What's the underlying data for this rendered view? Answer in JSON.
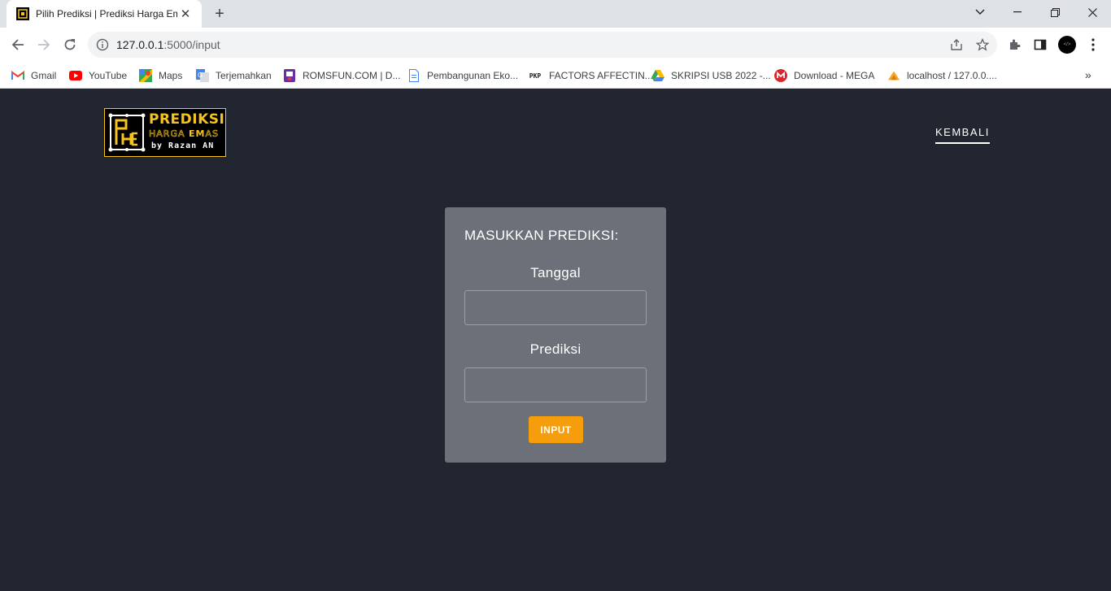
{
  "browser": {
    "tab_title": "Pilih Prediksi | Prediksi Harga Emas",
    "url_host": "127.0.0.1",
    "url_path": ":5000/input",
    "profile_text": "</>",
    "bookmarks": [
      {
        "label": "Gmail",
        "icon": "gmail-icon"
      },
      {
        "label": "YouTube",
        "icon": "youtube-icon"
      },
      {
        "label": "Maps",
        "icon": "maps-icon"
      },
      {
        "label": "Terjemahkan",
        "icon": "translate-icon"
      },
      {
        "label": "ROMSFUN.COM | D...",
        "icon": "romsfun-icon"
      },
      {
        "label": "Pembangunan Eko...",
        "icon": "document-icon"
      },
      {
        "label": "FACTORS AFFECTIN...",
        "icon": "pkp-icon"
      },
      {
        "label": "SKRIPSI USB 2022 -...",
        "icon": "drive-icon"
      },
      {
        "label": "Download - MEGA",
        "icon": "mega-icon"
      },
      {
        "label": "localhost / 127.0.0....",
        "icon": "phpmyadmin-icon"
      }
    ],
    "bookmark_pkp_text": "PKP"
  },
  "logo": {
    "line1": "PREDIKSI",
    "line2a": "HARGA ",
    "line2b": "EM",
    "line2c": "AS",
    "line3": "by Razan AN"
  },
  "nav": {
    "back_label": "KEMBALI"
  },
  "form": {
    "title": "MASUKKAN PREDIKSI:",
    "date_label": "Tanggal",
    "date_value": "",
    "prediction_label": "Prediksi",
    "prediction_value": "",
    "submit_label": "INPUT"
  },
  "colors": {
    "background": "#212631",
    "card": "#6b7079",
    "accent": "#f59d0a",
    "logo_gold": "#f5c31c"
  }
}
